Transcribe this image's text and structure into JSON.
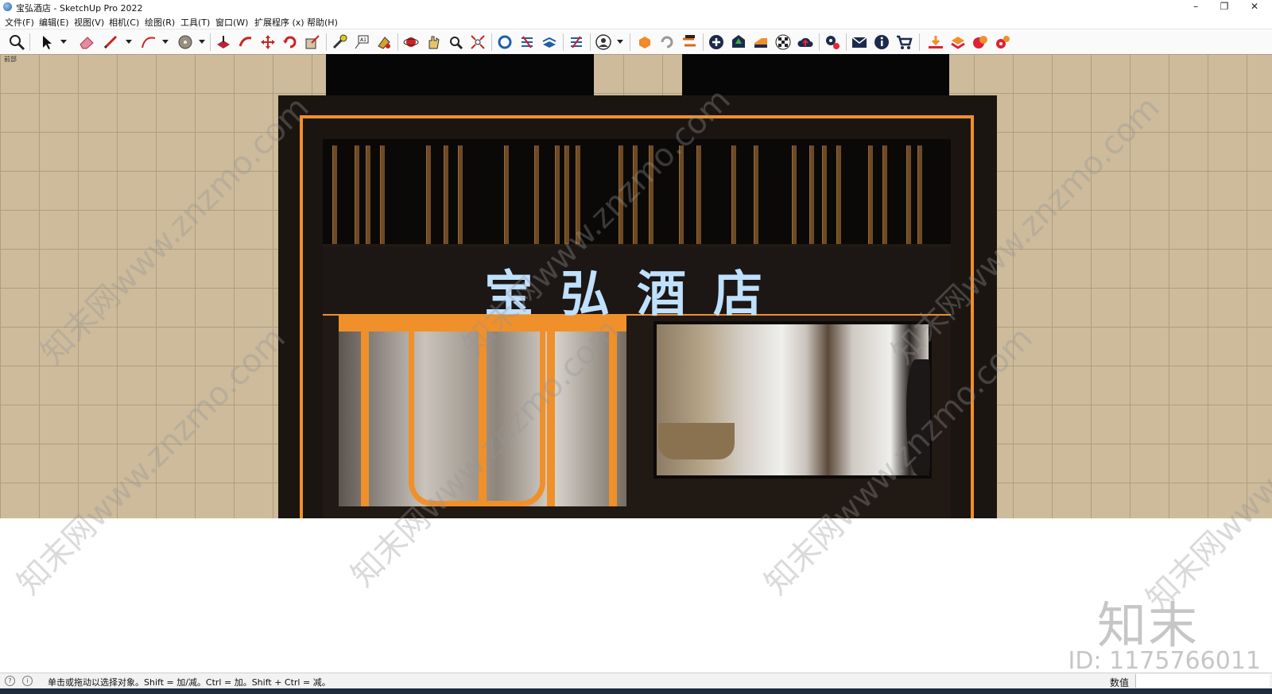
{
  "window": {
    "title": "宝弘酒店 - SketchUp Pro 2022",
    "minimize": "–",
    "restore": "❐",
    "close": "✕"
  },
  "menu": [
    "文件(F)",
    "编辑(E)",
    "视图(V)",
    "相机(C)",
    "绘图(R)",
    "工具(T)",
    "窗口(W)",
    "扩展程序 (x)",
    "帮助(H)"
  ],
  "toolbar_icons": [
    "zoom-icon",
    "select-arrow-icon",
    "eraser-icon",
    "pencil-icon",
    "arc-icon",
    "paint-bucket-icon",
    "push-pull-icon",
    "follow-me-icon",
    "move-icon",
    "rotate-icon",
    "scale-icon",
    "tape-measure-icon",
    "text-icon",
    "paint-icon",
    "orbit-icon",
    "pan-icon",
    "zoom-window-icon",
    "zoom-extents-icon",
    "warehouse-icon",
    "extension-warehouse-icon",
    "layout-icon",
    "styles-icon",
    "account-icon",
    "plugin-a-icon",
    "refresh-icon",
    "swap-icon",
    "add-icon",
    "tree-icon",
    "ruler-icon",
    "checker-icon",
    "cloud-upload-icon",
    "settings-gear-icon",
    "mail-icon",
    "info-icon",
    "cart-icon",
    "download-icon",
    "layers-icon",
    "plugin-b-icon",
    "plugin-c-icon"
  ],
  "scene": {
    "tab_label": "前部"
  },
  "sign": {
    "text": "宝弘酒店"
  },
  "watermark_text": "知末网www.znzmo.com",
  "brand": {
    "mark": "知末",
    "id": "ID: 1175766011"
  },
  "status": {
    "hint": "单击或拖动以选择对象。Shift = 加/减。Ctrl = 加。Shift + Ctrl = 减。",
    "measurements_label": "数值"
  },
  "colors": {
    "accent": "#f0902a",
    "facade": "#1b1512",
    "sign_text": "#bfe0ff",
    "wall_tile": "#cdbb9b"
  }
}
